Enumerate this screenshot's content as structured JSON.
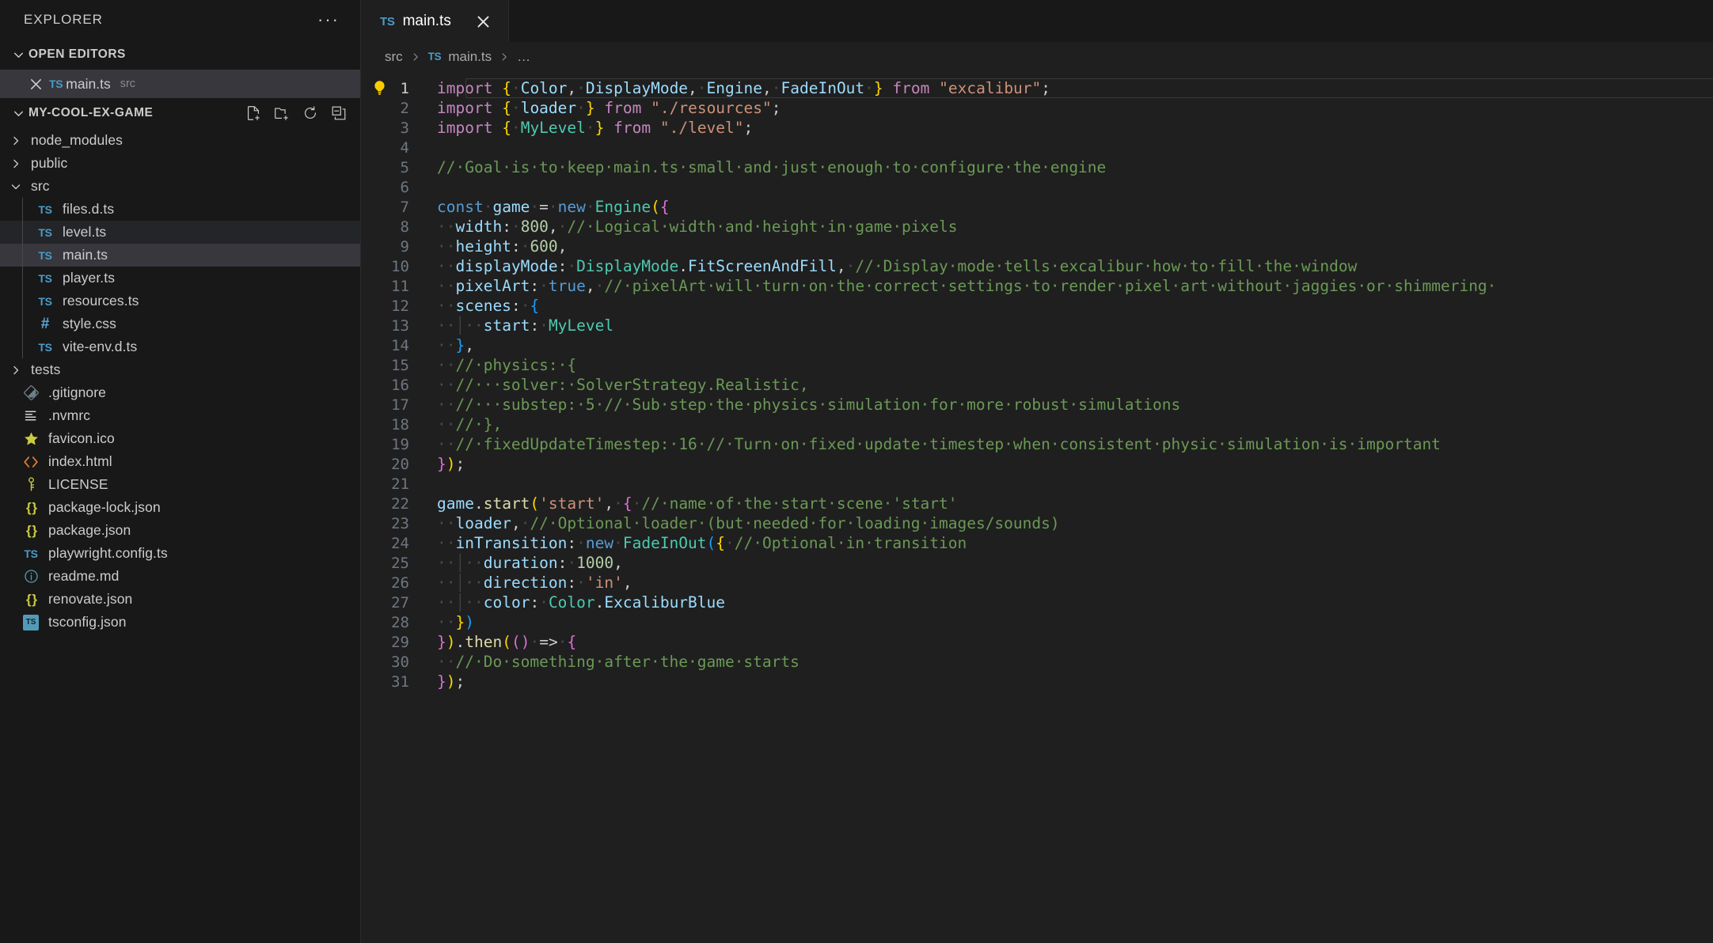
{
  "sidebar": {
    "title": "EXPLORER",
    "more_label": "···",
    "open_editors": {
      "label": "OPEN EDITORS",
      "items": [
        {
          "name": "main.ts",
          "description": "src",
          "icon": "typescript-icon",
          "selected": true
        }
      ]
    },
    "workspace": {
      "label": "MY-COOL-EX-GAME",
      "actions": [
        {
          "name": "new-file-icon",
          "tooltip": "New File..."
        },
        {
          "name": "new-folder-icon",
          "tooltip": "New Folder..."
        },
        {
          "name": "refresh-icon",
          "tooltip": "Refresh Explorer"
        },
        {
          "name": "collapse-all-icon",
          "tooltip": "Collapse Folders in Explorer"
        }
      ]
    },
    "tree": [
      {
        "label": "node_modules",
        "type": "folder",
        "expanded": false,
        "depth": 0,
        "icon": "chevron-right-icon"
      },
      {
        "label": "public",
        "type": "folder",
        "expanded": false,
        "depth": 0,
        "icon": "chevron-right-icon"
      },
      {
        "label": "src",
        "type": "folder",
        "expanded": true,
        "depth": 0,
        "icon": "chevron-down-icon"
      },
      {
        "label": "files.d.ts",
        "type": "file",
        "depth": 1,
        "icon": "typescript-icon"
      },
      {
        "label": "level.ts",
        "type": "file",
        "depth": 1,
        "icon": "typescript-icon",
        "state": "hovered"
      },
      {
        "label": "main.ts",
        "type": "file",
        "depth": 1,
        "icon": "typescript-icon",
        "state": "selected"
      },
      {
        "label": "player.ts",
        "type": "file",
        "depth": 1,
        "icon": "typescript-icon"
      },
      {
        "label": "resources.ts",
        "type": "file",
        "depth": 1,
        "icon": "typescript-icon"
      },
      {
        "label": "style.css",
        "type": "file",
        "depth": 1,
        "icon": "css-icon"
      },
      {
        "label": "vite-env.d.ts",
        "type": "file",
        "depth": 1,
        "icon": "typescript-icon"
      },
      {
        "label": "tests",
        "type": "folder",
        "expanded": false,
        "depth": 0,
        "icon": "chevron-right-icon"
      },
      {
        "label": ".gitignore",
        "type": "file",
        "depth": 0,
        "icon": "git-icon"
      },
      {
        "label": ".nvmrc",
        "type": "file",
        "depth": 0,
        "icon": "config-lines-icon"
      },
      {
        "label": "favicon.ico",
        "type": "file",
        "depth": 0,
        "icon": "star-icon"
      },
      {
        "label": "index.html",
        "type": "file",
        "depth": 0,
        "icon": "html-icon"
      },
      {
        "label": "LICENSE",
        "type": "file",
        "depth": 0,
        "icon": "key-icon"
      },
      {
        "label": "package-lock.json",
        "type": "file",
        "depth": 0,
        "icon": "json-icon"
      },
      {
        "label": "package.json",
        "type": "file",
        "depth": 0,
        "icon": "json-icon"
      },
      {
        "label": "playwright.config.ts",
        "type": "file",
        "depth": 0,
        "icon": "typescript-icon"
      },
      {
        "label": "readme.md",
        "type": "file",
        "depth": 0,
        "icon": "info-icon"
      },
      {
        "label": "renovate.json",
        "type": "file",
        "depth": 0,
        "icon": "json-icon"
      },
      {
        "label": "tsconfig.json",
        "type": "file",
        "depth": 0,
        "icon": "tsconfig-icon"
      }
    ]
  },
  "editor": {
    "tabs": [
      {
        "label": "main.ts",
        "icon": "typescript-icon",
        "active": true,
        "close_label": "×"
      }
    ],
    "breadcrumb": [
      {
        "label": "src",
        "icon": null
      },
      {
        "label": "main.ts",
        "icon": "typescript-icon"
      },
      {
        "label": "…",
        "icon": null
      }
    ],
    "breadcrumb_separator": "›",
    "gutter": {
      "lightbulb_line": 1,
      "icon": "lightbulb-icon"
    },
    "code": {
      "language": "typescript",
      "lines": [
        {
          "n": 1,
          "text": "import { Color, DisplayMode, Engine, FadeInOut } from \"excalibur\";"
        },
        {
          "n": 2,
          "text": "import { loader } from \"./resources\";"
        },
        {
          "n": 3,
          "text": "import { MyLevel } from \"./level\";"
        },
        {
          "n": 4,
          "text": ""
        },
        {
          "n": 5,
          "text": "// Goal is to keep main.ts small and just enough to configure the engine"
        },
        {
          "n": 6,
          "text": ""
        },
        {
          "n": 7,
          "text": "const game = new Engine({"
        },
        {
          "n": 8,
          "text": "  width: 800, // Logical width and height in game pixels"
        },
        {
          "n": 9,
          "text": "  height: 600,"
        },
        {
          "n": 10,
          "text": "  displayMode: DisplayMode.FitScreenAndFill, // Display mode tells excalibur how to fill the window"
        },
        {
          "n": 11,
          "text": "  pixelArt: true, // pixelArt will turn on the correct settings to render pixel art without jaggies or shimmering"
        },
        {
          "n": 12,
          "text": "  scenes: {"
        },
        {
          "n": 13,
          "text": "    start: MyLevel"
        },
        {
          "n": 14,
          "text": "  },"
        },
        {
          "n": 15,
          "text": "  // physics: {"
        },
        {
          "n": 16,
          "text": "  //   solver: SolverStrategy.Realistic,"
        },
        {
          "n": 17,
          "text": "  //   substep: 5 // Sub step the physics simulation for more robust simulations"
        },
        {
          "n": 18,
          "text": "  // },"
        },
        {
          "n": 19,
          "text": "  // fixedUpdateTimestep: 16 // Turn on fixed update timestep when consistent physic simulation is important"
        },
        {
          "n": 20,
          "text": "});"
        },
        {
          "n": 21,
          "text": ""
        },
        {
          "n": 22,
          "text": "game.start('start', { // name of the start scene 'start'"
        },
        {
          "n": 23,
          "text": "  loader, // Optional loader (but needed for loading images/sounds)"
        },
        {
          "n": 24,
          "text": "  inTransition: new FadeInOut({ // Optional in transition"
        },
        {
          "n": 25,
          "text": "    duration: 1000,"
        },
        {
          "n": 26,
          "text": "    direction: 'in',"
        },
        {
          "n": 27,
          "text": "    color: Color.ExcaliburBlue"
        },
        {
          "n": 28,
          "text": "  })"
        },
        {
          "n": 29,
          "text": "}).then(() => {"
        },
        {
          "n": 30,
          "text": "  // Do something after the game starts"
        },
        {
          "n": 31,
          "text": "});"
        }
      ]
    }
  },
  "colors": {
    "sidebar_bg": "#181818",
    "editor_bg": "#1f1f1f",
    "selection_bg": "#37373d",
    "keyword": "#C586C0",
    "control": "#569CD6",
    "identifier": "#9CDCFE",
    "type": "#4EC9B0",
    "string": "#CE9178",
    "number": "#B5CEA8",
    "comment": "#6A9955",
    "function": "#DCDCAA",
    "bracket1": "#FFD700",
    "bracket2": "#DA70D6",
    "bracket3": "#179FFF",
    "line_number": "#6e7681",
    "ts_icon": "#4a9cc8"
  }
}
